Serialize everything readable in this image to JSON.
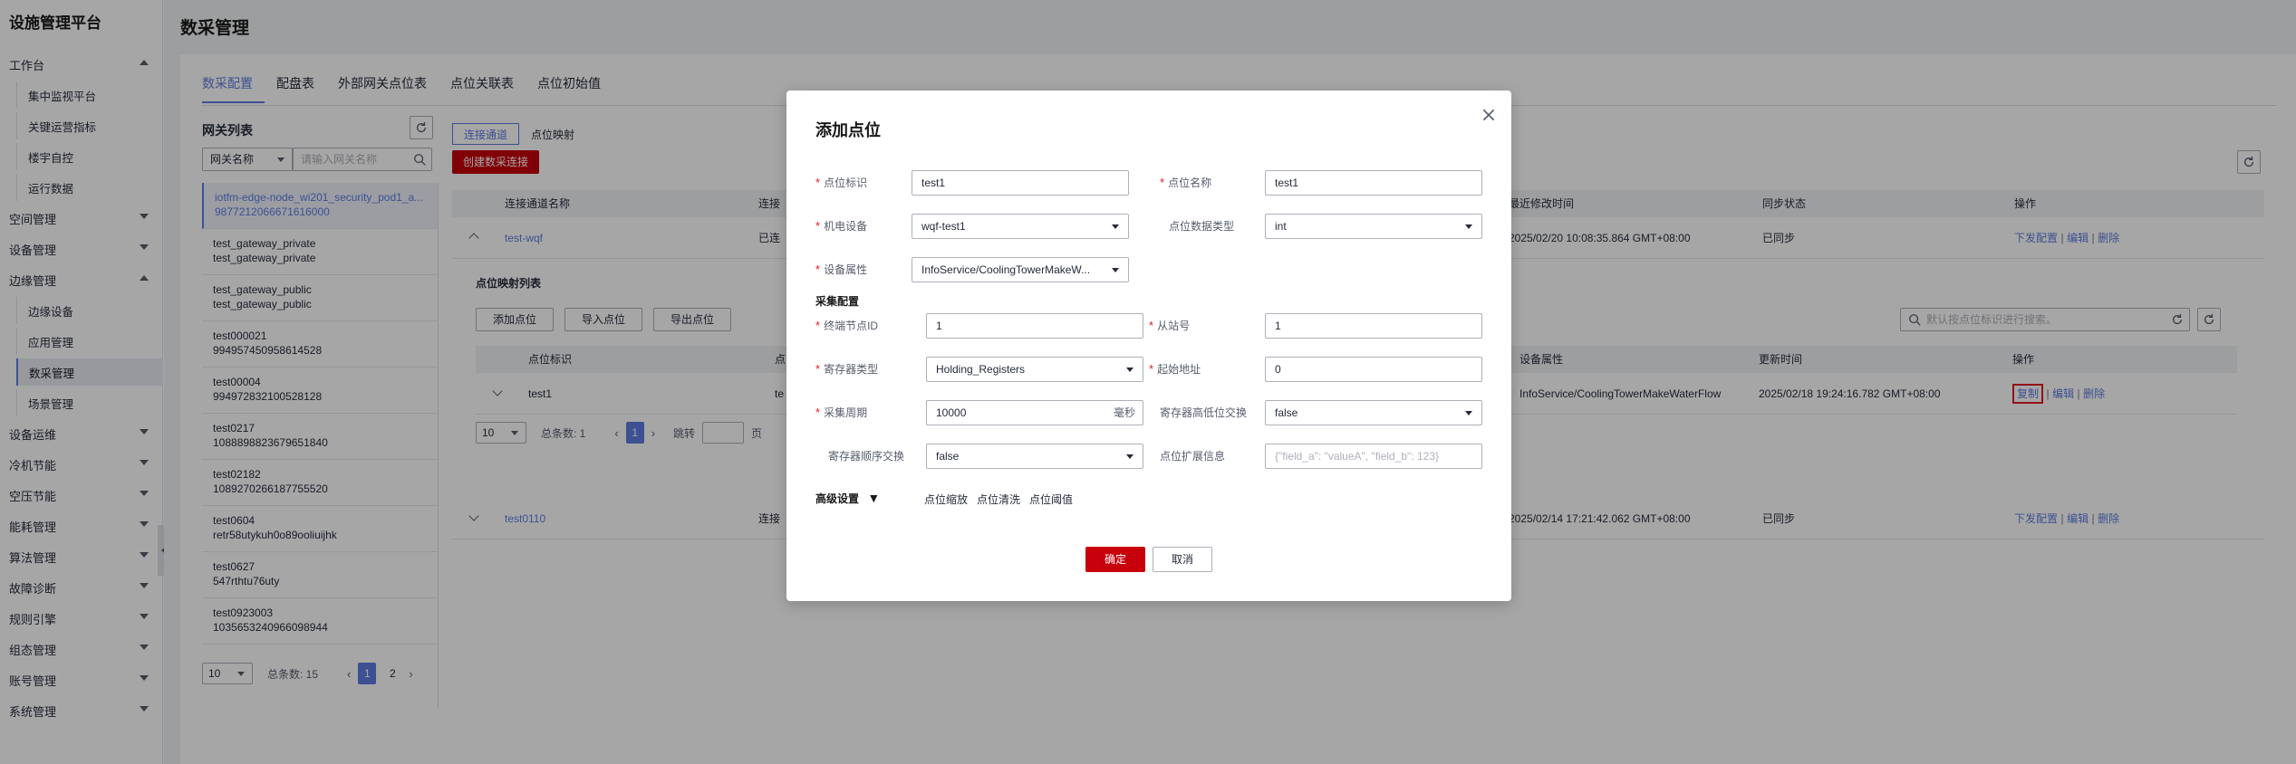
{
  "app_title": "设施管理平台",
  "sidebar": {
    "groups": [
      {
        "label": "工作台",
        "expanded": true,
        "children": [
          "集中监视平台",
          "关键运营指标",
          "楼宇自控",
          "运行数据"
        ]
      },
      {
        "label": "空间管理",
        "expanded": false
      },
      {
        "label": "设备管理",
        "expanded": false
      },
      {
        "label": "边缘管理",
        "expanded": true,
        "children": [
          "边缘设备",
          "应用管理",
          "数采管理",
          "场景管理"
        ]
      },
      {
        "label": "设备运维",
        "expanded": false
      },
      {
        "label": "冷机节能",
        "expanded": false
      },
      {
        "label": "空压节能",
        "expanded": false
      },
      {
        "label": "能耗管理",
        "expanded": false
      },
      {
        "label": "算法管理",
        "expanded": false
      },
      {
        "label": "故障诊断",
        "expanded": false
      },
      {
        "label": "规则引擎",
        "expanded": false
      },
      {
        "label": "组态管理",
        "expanded": false
      },
      {
        "label": "账号管理",
        "expanded": false
      },
      {
        "label": "系统管理",
        "expanded": false
      }
    ],
    "active_child": "数采管理"
  },
  "page": {
    "title": "数采管理",
    "tabs": [
      "数采配置",
      "配盘表",
      "外部网关点位表",
      "点位关联表",
      "点位初始值"
    ],
    "active_tab": "数采配置"
  },
  "gateway_panel": {
    "title": "网关列表",
    "filter_select": "网关名称",
    "search_placeholder": "请输入网关名称",
    "items": [
      {
        "line1": "iotfm-edge-node_wi201_security_pod1_a...",
        "line2": "9877212066671616000"
      },
      {
        "line1": "test_gateway_private",
        "line2": "test_gateway_private"
      },
      {
        "line1": "test_gateway_public",
        "line2": "test_gateway_public"
      },
      {
        "line1": "test000021",
        "line2": "994957450958614528"
      },
      {
        "line1": "test00004",
        "line2": "994972832100528128"
      },
      {
        "line1": "test0217",
        "line2": "1088898823679651840"
      },
      {
        "line1": "test02182",
        "line2": "1089270266187755520"
      },
      {
        "line1": "test0604",
        "line2": "retr58utykuh0o89ooliuijhk"
      },
      {
        "line1": "test0627",
        "line2": "547rthtu76uty"
      },
      {
        "line1": "test0923003",
        "line2": "1035653240966098944"
      }
    ],
    "pager": {
      "size": "10",
      "total": "总条数: 15",
      "pages": [
        "1",
        "2"
      ],
      "current": "1"
    }
  },
  "right_panel": {
    "sub_tabs": [
      "连接通道",
      "点位映射"
    ],
    "active_sub_tab": "连接通道",
    "create_button": "创建数采连接",
    "table_headers": [
      "连接通道名称",
      "连接",
      "最近修改时间",
      "同步状态",
      "操作"
    ],
    "rows": [
      {
        "name": "test-wqf",
        "conn": "已连",
        "modified": "2025/02/20 10:08:35.864 GMT+08:00",
        "sync": "已同步",
        "actions": [
          "下发配置",
          "编辑",
          "删除"
        ]
      },
      {
        "name": "test0110",
        "conn": "连接",
        "modified": "2025/02/14 17:21:42.062 GMT+08:00",
        "sync": "已同步",
        "actions": [
          "下发配置",
          "编辑",
          "删除"
        ]
      }
    ],
    "mapping": {
      "title": "点位映射列表",
      "buttons": [
        "添加点位",
        "导入点位",
        "导出点位"
      ],
      "search_placeholder": "默认按点位标识进行搜索。",
      "headers": [
        "点位标识",
        "点",
        "设备属性",
        "更新时间",
        "操作"
      ],
      "row": {
        "id": "test1",
        "short": "te",
        "attr": "InfoService/CoolingTowerMakeWaterFlow",
        "updated": "2025/02/18 19:24:16.782 GMT+08:00",
        "actions": [
          "复制",
          "编辑",
          "删除"
        ]
      },
      "pager": {
        "size": "10",
        "total": "总条数: 1",
        "current": "1",
        "jump": "跳转",
        "page_suffix": "页"
      }
    }
  },
  "modal": {
    "title": "添加点位",
    "fields": {
      "point_id_label": "点位标识",
      "point_id_value": "test1",
      "point_name_label": "点位名称",
      "point_name_value": "test1",
      "device_label": "机电设备",
      "device_value": "wqf-test1",
      "data_type_label": "点位数据类型",
      "data_type_value": "int",
      "attr_label": "设备属性",
      "attr_value": "InfoService/CoolingTowerMakeW...",
      "group_title": "采集配置",
      "node_id_label": "终端节点ID",
      "node_id_value": "1",
      "slave_label": "从站号",
      "slave_value": "1",
      "reg_type_label": "寄存器类型",
      "reg_type_value": "Holding_Registers",
      "start_addr_label": "起始地址",
      "start_addr_value": "0",
      "period_label": "采集周期",
      "period_value": "10000",
      "period_unit": "毫秒",
      "swap_hl_label": "寄存器高低位交换",
      "swap_hl_value": "false",
      "swap_order_label": "寄存器顺序交换",
      "swap_order_value": "false",
      "ext_label": "点位扩展信息",
      "ext_placeholder": "{\"field_a\": \"valueA\", \"field_b\": 123}"
    },
    "advanced": {
      "label": "高级设置",
      "links": [
        "点位缩放",
        "点位清洗",
        "点位阈值"
      ]
    },
    "confirm": "确定",
    "cancel": "取消"
  },
  "colors": {
    "brand_red": "#c7000b",
    "accent_blue": "#5e7ce0"
  }
}
